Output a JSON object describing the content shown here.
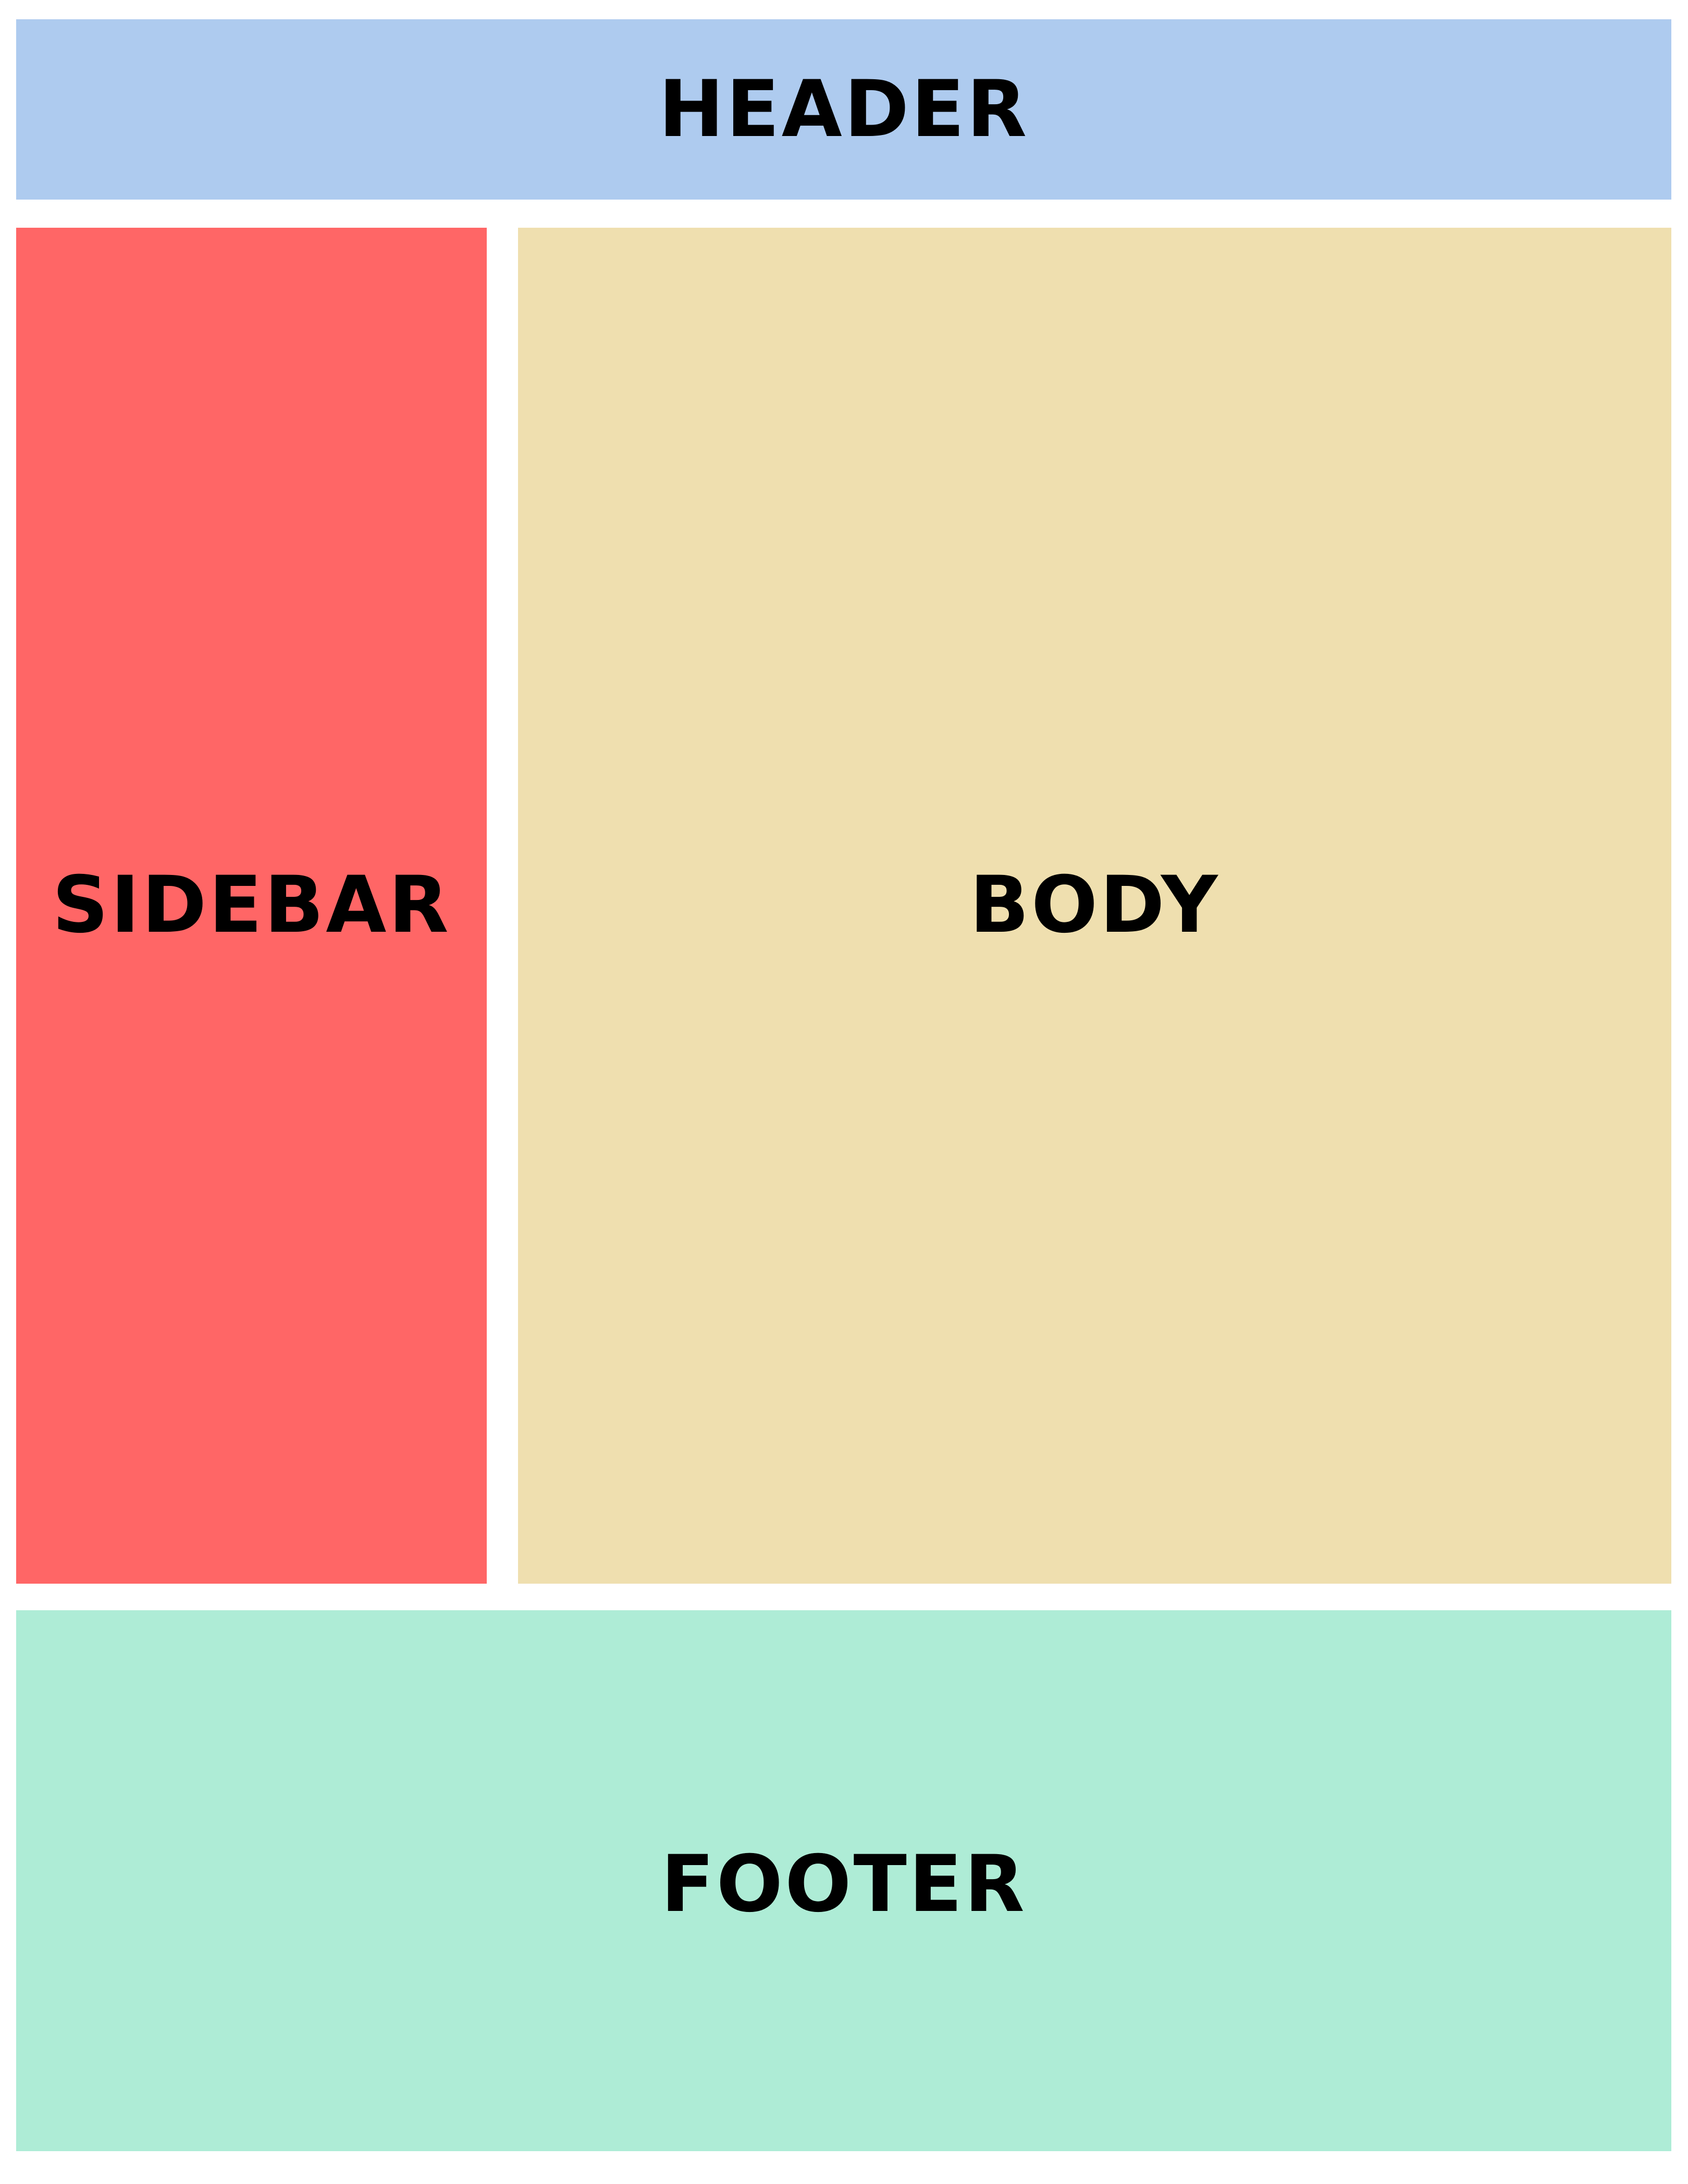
{
  "regions": {
    "header": {
      "label": "HEADER",
      "color": "#aecbef"
    },
    "sidebar": {
      "label": "SIDEBAR",
      "color": "#ff6666"
    },
    "body": {
      "label": "BODY",
      "color": "#efdfaf"
    },
    "footer": {
      "label": "FOOTER",
      "color": "#aeecd6"
    }
  }
}
